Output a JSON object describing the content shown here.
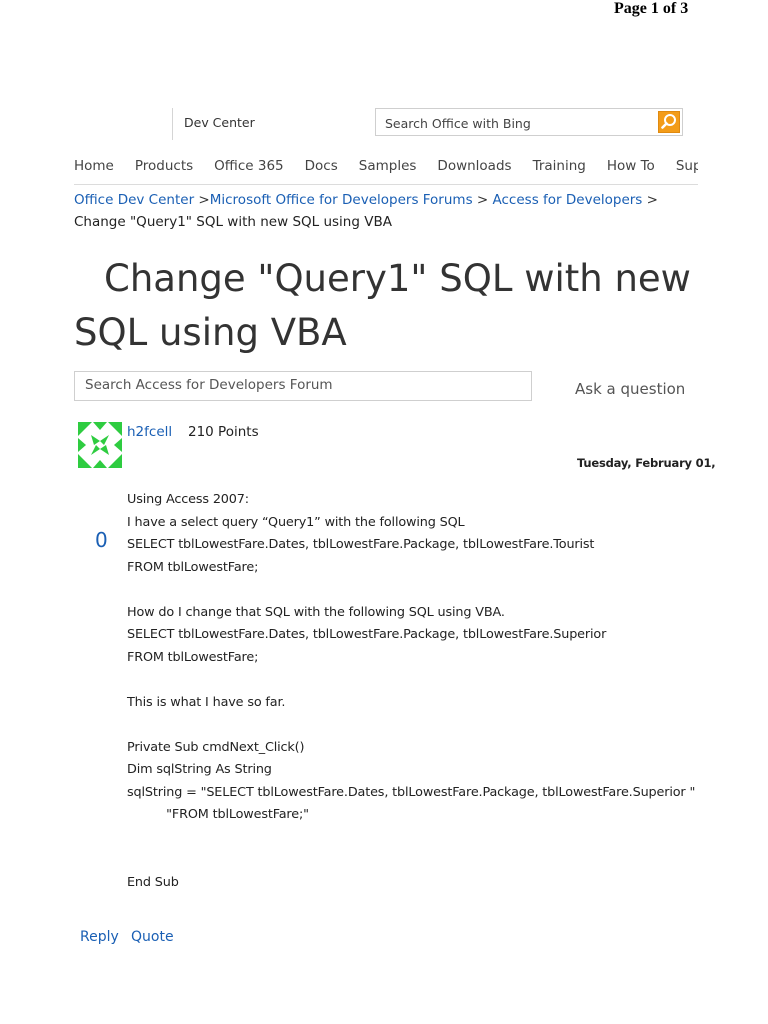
{
  "page_counter": "Page 1 of 3",
  "header": {
    "dev_center_label": "Dev Center",
    "search_placeholder": "Search Office with Bing"
  },
  "nav": {
    "items": [
      "Home",
      "Products",
      "Office 365",
      "Docs",
      "Samples",
      "Downloads",
      "Training",
      "How To",
      "Support"
    ]
  },
  "breadcrumb": {
    "item1": "Office Dev Center",
    "sep1": " >",
    "item2": "Microsoft Office for Developers Forums",
    "sep2": " > ",
    "item3": "Access for Developers",
    "sep3": " >",
    "current": "Change \"Query1\" SQL with new SQL using VBA"
  },
  "title": "Change \"Query1\" SQL with new SQL using VBA",
  "forum_search": {
    "placeholder": "Search Access for Developers Forum"
  },
  "ask_question_label": "Ask a question",
  "post": {
    "username": "h2fcell",
    "points": "210 Points",
    "date": "Tuesday, February 01,",
    "votes": "0",
    "lines": [
      "Using Access 2007:",
      "I have a select query “Query1” with the following SQL",
      "SELECT tblLowestFare.Dates, tblLowestFare.Package, tblLowestFare.Tourist",
      "FROM tblLowestFare;",
      "",
      "How do I change that SQL with the following SQL using VBA.",
      "SELECT tblLowestFare.Dates, tblLowestFare.Package, tblLowestFare.Superior",
      "FROM tblLowestFare;",
      "",
      "This is what I have so far.",
      "",
      "Private Sub cmdNext_Click()",
      "Dim sqlString As String",
      "sqlString = \"SELECT tblLowestFare.Dates, tblLowestFare.Package, tblLowestFare.Superior \"",
      "          \"FROM tblLowestFare;\"",
      "",
      "",
      "End Sub"
    ]
  },
  "actions": {
    "reply_label": "Reply",
    "quote_label": "Quote"
  },
  "colors": {
    "link": "#1a5fb4",
    "search_button": "#f39c19",
    "avatar": "#2ecc40"
  },
  "icons": {
    "search_button": "magnifier-icon",
    "avatar": "identicon-avatar"
  }
}
